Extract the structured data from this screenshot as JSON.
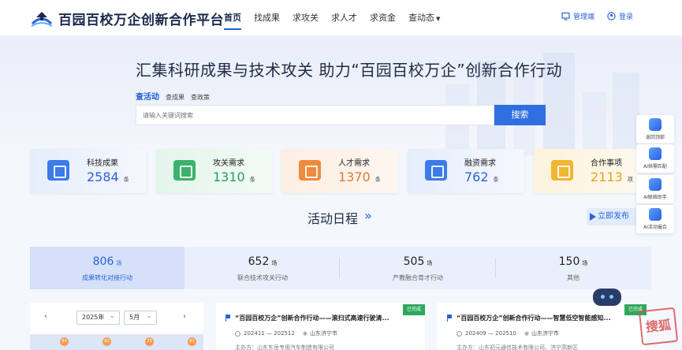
{
  "header": {
    "site_name": "百园百校万企创新合作平台",
    "nav": [
      "首页",
      "找成果",
      "求攻关",
      "求人才",
      "求资金",
      "查动态"
    ],
    "manage_label": "管理端",
    "login_label": "登录"
  },
  "hero": {
    "title": "汇集科研成果与技术攻关 助力“百园百校万企”创新合作行动",
    "search_tabs": [
      "查活动",
      "查成果",
      "查政策"
    ],
    "search_placeholder": "请输入关键词搜索",
    "search_button": "搜索"
  },
  "stats": [
    {
      "label": "科技成果",
      "value": "2584",
      "unit": "条",
      "color": "#2b62d8"
    },
    {
      "label": "攻关需求",
      "value": "1310",
      "unit": "条",
      "color": "#23a05a"
    },
    {
      "label": "人才需求",
      "value": "1370",
      "unit": "条",
      "color": "#e07a2e"
    },
    {
      "label": "融资需求",
      "value": "762",
      "unit": "条",
      "color": "#2b62d8"
    },
    {
      "label": "合作事项",
      "value": "2113",
      "unit": "项",
      "color": "#e0a41e"
    }
  ],
  "schedule": {
    "title": "活动日程",
    "arrow": "»",
    "publish_label": "立即发布",
    "band": [
      {
        "value": "806",
        "unit": "场",
        "label": "成果转化对接行动"
      },
      {
        "value": "652",
        "unit": "场",
        "label": "联合技术攻关行动"
      },
      {
        "value": "505",
        "unit": "场",
        "label": "产教融合育才行动"
      },
      {
        "value": "150",
        "unit": "场",
        "label": "其他"
      }
    ]
  },
  "calendar": {
    "prev": "‹",
    "next": "›",
    "year": "2025年",
    "month": "5月",
    "day_counts": [
      "84",
      "82",
      "73",
      "81"
    ]
  },
  "activities": [
    {
      "title": "“百园百校万企”创新合作行动——滚扫式高速行驶清...",
      "badge": "已完成",
      "date": "202411 — 202512",
      "location": "山东济宁市",
      "org": "主办方：山东东岳专用汽车制造有限公司"
    },
    {
      "title": "“百园百校万企”创新合作行动——智慧低空智能感知...",
      "badge": "已完成",
      "date": "202409 — 202510",
      "location": "山东济宁市",
      "org": "主办方：山东初元通信技术有限公司、济宁高新区"
    }
  ],
  "sidebar": [
    "返回顶部",
    "AI供需匹配",
    "AI联络助手",
    "AI活动撮合"
  ],
  "watermark": "搜狐"
}
